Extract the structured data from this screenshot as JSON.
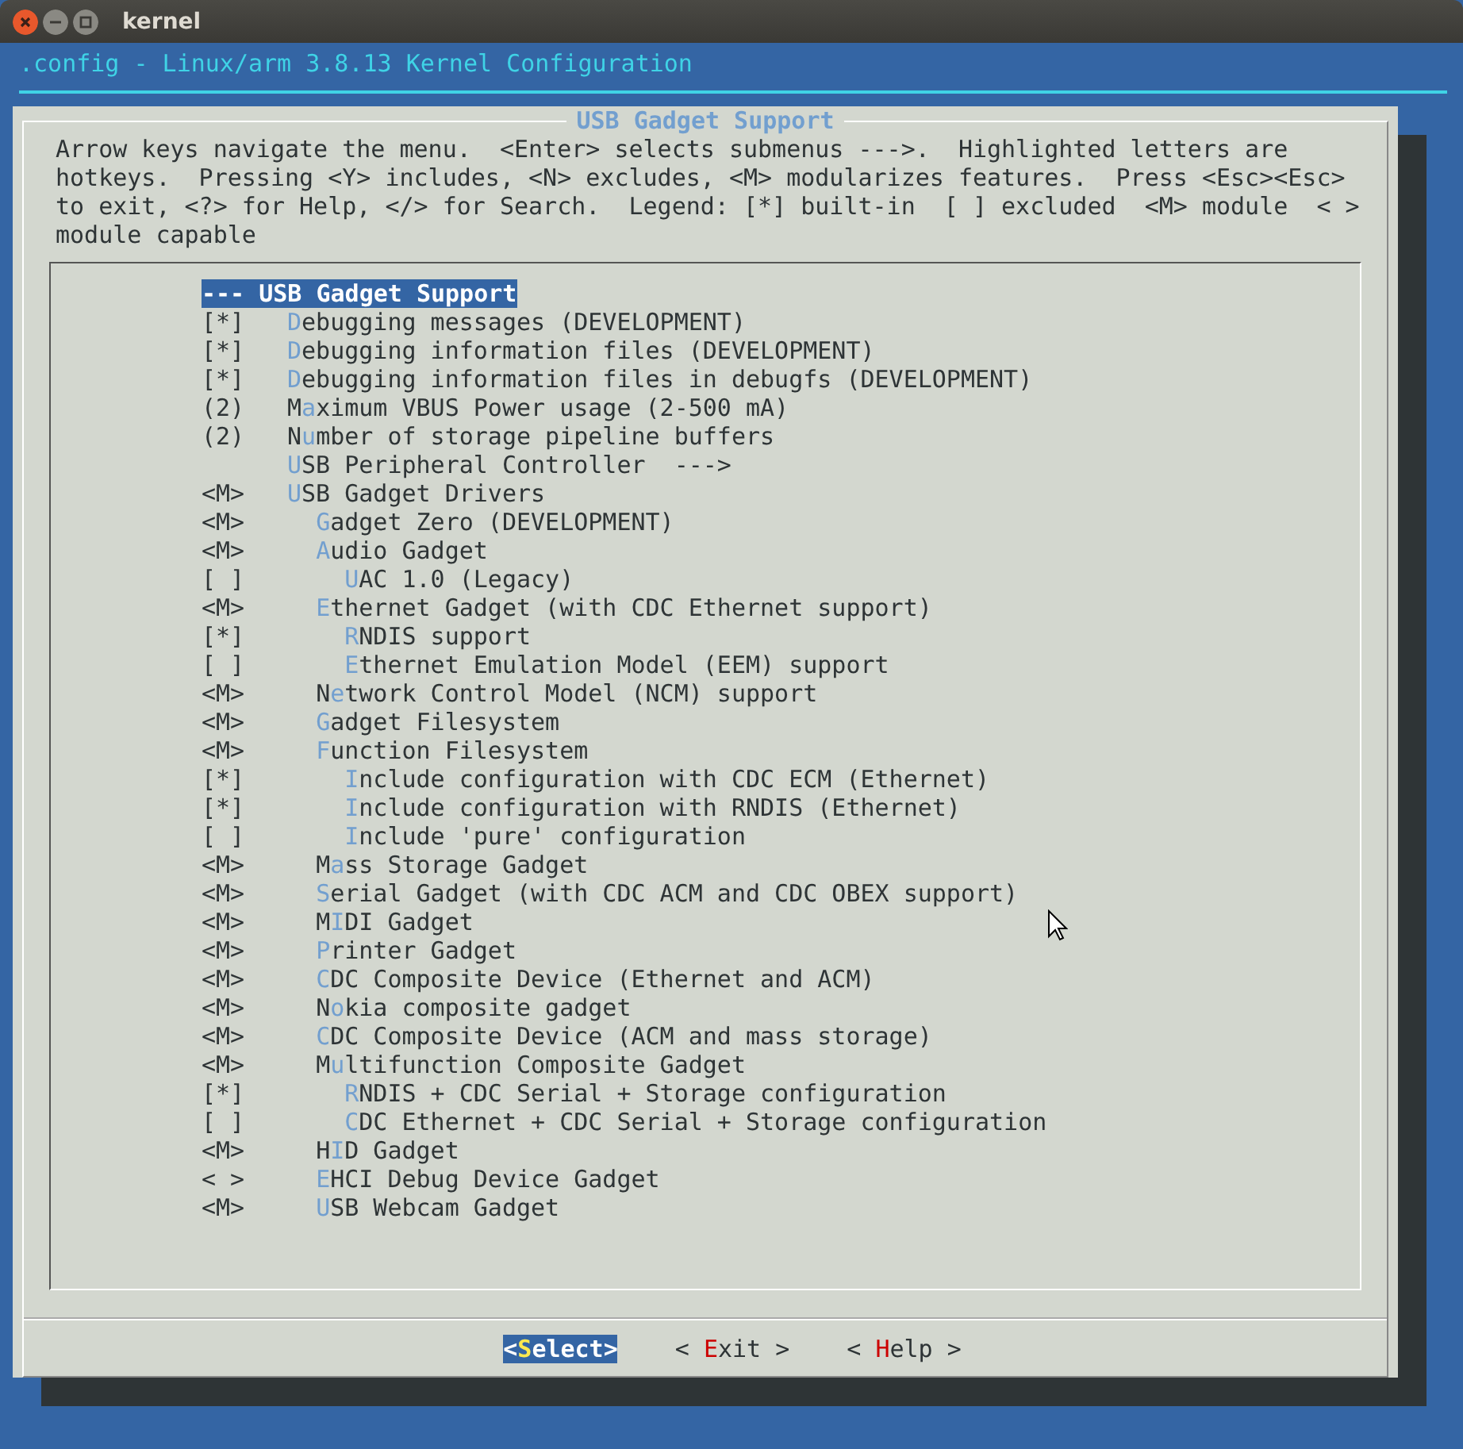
{
  "window": {
    "title": "kernel"
  },
  "terminal": {
    "header": ".config - Linux/arm 3.8.13 Kernel Configuration"
  },
  "dialog": {
    "title": "USB Gadget Support",
    "help": "Arrow keys navigate the menu.  <Enter> selects submenus --->.  Highlighted letters are\nhotkeys.  Pressing <Y> includes, <N> excludes, <M> modularizes features.  Press <Esc><Esc>\nto exit, <?> for Help, </> for Search.  Legend: [*] built-in  [ ] excluded  <M> module  < >\nmodule capable",
    "menu_root": {
      "prompt": "---",
      "label": "USB Gadget Support",
      "selected": true
    },
    "items": [
      {
        "prompt": "[*]",
        "hotkey": "D",
        "rest": "ebugging messages (DEVELOPMENT)",
        "selected": false
      },
      {
        "prompt": "[*]",
        "hotkey": "D",
        "rest": "ebugging information files (DEVELOPMENT)",
        "selected": false
      },
      {
        "prompt": "[*]",
        "hotkey": "D",
        "rest": "ebugging information files in debugfs (DEVELOPMENT)",
        "selected": false
      },
      {
        "prompt": "(2)",
        "lead": "M",
        "hotkey": "a",
        "rest": "ximum VBUS Power usage (2-500 mA)",
        "selected": false
      },
      {
        "prompt": "(2)",
        "lead": "N",
        "hotkey": "u",
        "rest": "mber of storage pipeline buffers",
        "selected": false
      },
      {
        "hotkey": "U",
        "rest": "SB Peripheral Controller  --->",
        "selected": false
      },
      {
        "prompt": "<M>",
        "hotkey": "U",
        "rest": "SB Gadget Drivers",
        "selected": false,
        "children": [
          {
            "prompt": "<M>",
            "hotkey": "G",
            "rest": "adget Zero (DEVELOPMENT)",
            "selected": false
          },
          {
            "prompt": "<M>",
            "hotkey": "A",
            "rest": "udio Gadget",
            "selected": false,
            "children": [
              {
                "prompt": "[ ]",
                "hotkey": "U",
                "rest": "AC 1.0 (Legacy)",
                "selected": false
              }
            ]
          },
          {
            "prompt": "<M>",
            "hotkey": "E",
            "rest": "thernet Gadget (with CDC Ethernet support)",
            "selected": false,
            "children": [
              {
                "prompt": "[*]",
                "hotkey": "R",
                "rest": "NDIS support",
                "selected": false
              },
              {
                "prompt": "[ ]",
                "hotkey": "E",
                "rest": "thernet Emulation Model (EEM) support",
                "selected": false
              }
            ]
          },
          {
            "prompt": "<M>",
            "lead": "N",
            "hotkey": "e",
            "rest": "twork Control Model (NCM) support",
            "selected": false
          },
          {
            "prompt": "<M>",
            "hotkey": "G",
            "rest": "adget Filesystem",
            "selected": false
          },
          {
            "prompt": "<M>",
            "hotkey": "F",
            "rest": "unction Filesystem",
            "selected": false,
            "children": [
              {
                "prompt": "[*]",
                "hotkey": "I",
                "rest": "nclude configuration with CDC ECM (Ethernet)",
                "selected": false
              },
              {
                "prompt": "[*]",
                "hotkey": "I",
                "rest": "nclude configuration with RNDIS (Ethernet)",
                "selected": false
              },
              {
                "prompt": "[ ]",
                "hotkey": "I",
                "rest": "nclude 'pure' configuration",
                "selected": false
              }
            ]
          },
          {
            "prompt": "<M>",
            "lead": "M",
            "hotkey": "a",
            "rest": "ss Storage Gadget",
            "selected": false
          },
          {
            "prompt": "<M>",
            "hotkey": "S",
            "rest": "erial Gadget (with CDC ACM and CDC OBEX support)",
            "selected": false
          },
          {
            "prompt": "<M>",
            "lead": "M",
            "hotkey": "I",
            "rest": "DI Gadget",
            "selected": false
          },
          {
            "prompt": "<M>",
            "hotkey": "P",
            "rest": "rinter Gadget",
            "selected": false
          },
          {
            "prompt": "<M>",
            "hotkey": "C",
            "rest": "DC Composite Device (Ethernet and ACM)",
            "selected": false
          },
          {
            "prompt": "<M>",
            "lead": "N",
            "hotkey": "o",
            "rest": "kia composite gadget",
            "selected": false
          },
          {
            "prompt": "<M>",
            "hotkey": "C",
            "rest": "DC Composite Device (ACM and mass storage)",
            "selected": false
          },
          {
            "prompt": "<M>",
            "lead": "M",
            "hotkey": "u",
            "rest": "ltifunction Composite Gadget",
            "selected": false,
            "children": [
              {
                "prompt": "[*]",
                "hotkey": "R",
                "rest": "NDIS + CDC Serial + Storage configuration",
                "selected": false
              },
              {
                "prompt": "[ ]",
                "hotkey": "C",
                "rest": "DC Ethernet + CDC Serial + Storage configuration",
                "selected": false
              }
            ]
          },
          {
            "prompt": "<M>",
            "lead": "H",
            "hotkey": "I",
            "rest": "D Gadget",
            "selected": false
          },
          {
            "prompt": "< >",
            "hotkey": "E",
            "rest": "HCI Debug Device Gadget",
            "selected": false
          },
          {
            "prompt": "<M>",
            "hotkey": "U",
            "rest": "SB Webcam Gadget",
            "selected": false
          }
        ]
      }
    ]
  },
  "buttons": [
    {
      "pre": "<",
      "hotkey": "S",
      "post": "elect>",
      "selected": true
    },
    {
      "pre": "< ",
      "hotkey": "E",
      "post": "xit >",
      "selected": false
    },
    {
      "pre": "< ",
      "hotkey": "H",
      "post": "elp >",
      "selected": false
    }
  ]
}
